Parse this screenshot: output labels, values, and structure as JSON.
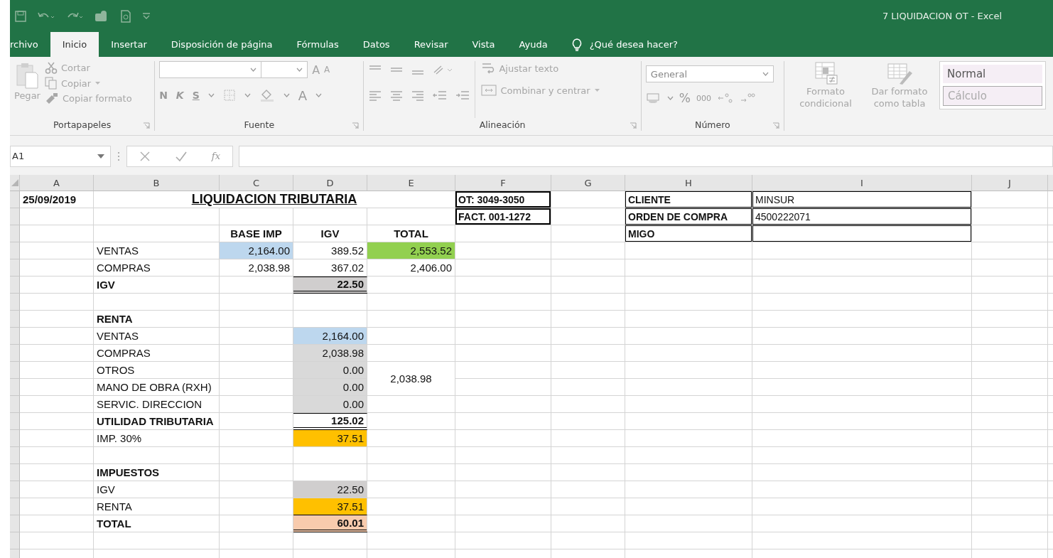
{
  "window": {
    "title": "7 LIQUIDACION OT  -  Excel"
  },
  "tabs": [
    {
      "label": "rchivo",
      "selected": false
    },
    {
      "label": "Inicio",
      "selected": true
    },
    {
      "label": "Insertar",
      "selected": false
    },
    {
      "label": "Disposición de página",
      "selected": false
    },
    {
      "label": "Fórmulas",
      "selected": false
    },
    {
      "label": "Datos",
      "selected": false
    },
    {
      "label": "Revisar",
      "selected": false
    },
    {
      "label": "Vista",
      "selected": false
    },
    {
      "label": "Ayuda",
      "selected": false
    }
  ],
  "tell_me": "¿Qué desea hacer?",
  "clipboard": {
    "label": "Portapapeles",
    "paste": "Pegar",
    "cut": "Cortar",
    "copy": "Copiar",
    "format_painter": "Copiar formato"
  },
  "font": {
    "label": "Fuente",
    "grow": "A",
    "shrink": "A",
    "bold": "N",
    "italic": "K",
    "underline": "S",
    "font_color": "A"
  },
  "alignment": {
    "label": "Alineación",
    "wrap": "Ajustar texto",
    "merge": "Combinar y centrar"
  },
  "number": {
    "label": "Número",
    "format": "General",
    "percent": "%",
    "thousands": "000"
  },
  "styles": {
    "conditional": "Formato condicional",
    "as_table": "Dar formato como tabla",
    "cell_styles": [
      "Normal",
      "Cálculo"
    ]
  },
  "formula_bar": {
    "name_box": "A1",
    "function_label": "fx"
  },
  "sheet": {
    "columns": [
      {
        "label": "A"
      },
      {
        "label": "B"
      },
      {
        "label": "C"
      },
      {
        "label": "D"
      },
      {
        "label": "E"
      },
      {
        "label": "F"
      },
      {
        "label": "G"
      },
      {
        "label": "H"
      },
      {
        "label": "I"
      },
      {
        "label": "J"
      }
    ],
    "rows": [
      {
        "cells": [
          {
            "kind": "text",
            "bold": true,
            "text": "25/09/2019"
          },
          {
            "kind": "title",
            "merged_across": true,
            "text": "LIQUIDACION TRIBUTARIA"
          },
          "",
          "",
          "",
          {
            "kind": "text",
            "bold": true,
            "thick_box": true,
            "text": "OT: 3049-3050"
          },
          "",
          {
            "kind": "text",
            "bold": true,
            "boxed": true,
            "text": "CLIENTE"
          },
          {
            "kind": "text",
            "bold": false,
            "boxed": true,
            "text": "MINSUR"
          }
        ]
      },
      {
        "cells": [
          "",
          "",
          "",
          "",
          "",
          {
            "kind": "text",
            "bold": true,
            "thick_box": true,
            "text": "FACT. 001-1272"
          },
          "",
          {
            "kind": "text",
            "bold": true,
            "boxed": true,
            "text": "ORDEN DE COMPRA"
          },
          {
            "kind": "text",
            "bold": false,
            "boxed": true,
            "text": "4500222071"
          }
        ]
      },
      {
        "cells": [
          "",
          "",
          {
            "kind": "heading",
            "text": "BASE IMP"
          },
          {
            "kind": "heading",
            "text": "IGV"
          },
          {
            "kind": "heading",
            "text": "TOTAL"
          },
          "",
          "",
          {
            "kind": "text",
            "bold": true,
            "boxed": true,
            "text": "MIGO"
          },
          {
            "kind": "text",
            "boxed": true
          }
        ]
      },
      {
        "cells": [
          "",
          {
            "kind": "text",
            "bold": false,
            "text": "VENTAS"
          },
          {
            "kind": "number",
            "bold": false,
            "color": "#bdd7ee",
            "text": "2,164.00"
          },
          {
            "kind": "number",
            "bold": false,
            "text": "389.52"
          },
          {
            "kind": "number",
            "bold": false,
            "color": "#92d050",
            "text": "2,553.52"
          }
        ]
      },
      {
        "cells": [
          "",
          {
            "kind": "text",
            "bold": false,
            "text": "COMPRAS"
          },
          {
            "kind": "number",
            "bold": false,
            "text": "2,038.98"
          },
          {
            "kind": "number",
            "bold": false,
            "text": "367.02"
          },
          {
            "kind": "number",
            "bold": false,
            "text": "2,406.00"
          }
        ]
      },
      {
        "cells": [
          "",
          {
            "kind": "text",
            "bold": true,
            "text": "IGV"
          },
          "",
          {
            "kind": "number",
            "bold": true,
            "color": "#d0cece",
            "top_rule": true,
            "double_underline": true,
            "text": "22.50"
          }
        ]
      },
      {
        "cells": []
      },
      {
        "cells": [
          "",
          {
            "kind": "text",
            "bold": true,
            "text": "RENTA"
          }
        ]
      },
      {
        "cells": [
          "",
          {
            "kind": "text",
            "bold": false,
            "text": "VENTAS"
          },
          "",
          {
            "kind": "number",
            "bold": false,
            "color": "#bdd7ee",
            "text": "2,164.00"
          }
        ]
      },
      {
        "cells": [
          "",
          {
            "kind": "text",
            "bold": false,
            "text": "COMPRAS"
          },
          "",
          {
            "kind": "number",
            "bold": false,
            "color": "#d9d9d9",
            "text": "2,038.98"
          }
        ]
      },
      {
        "cells": [
          "",
          {
            "kind": "text",
            "bold": false,
            "text": "OTROS"
          },
          "",
          {
            "kind": "number",
            "bold": false,
            "color": "#d9d9d9",
            "text": "0.00"
          },
          {
            "kind": "centered",
            "merged_down": true,
            "text": "2,038.98"
          }
        ]
      },
      {
        "cells": [
          "",
          {
            "kind": "text",
            "bold": false,
            "text": "MANO DE OBRA (RXH)"
          },
          "",
          {
            "kind": "number",
            "bold": false,
            "color": "#d9d9d9",
            "text": "0.00"
          }
        ]
      },
      {
        "cells": [
          "",
          {
            "kind": "text",
            "bold": false,
            "text": "SERVIC. DIRECCION"
          },
          "",
          {
            "kind": "number",
            "bold": false,
            "color": "#d9d9d9",
            "text": "0.00"
          }
        ]
      },
      {
        "cells": [
          "",
          {
            "kind": "text",
            "bold": true,
            "text": "UTILIDAD TRIBUTARIA"
          },
          "",
          {
            "kind": "number",
            "bold": true,
            "top_rule": true,
            "double_underline": true,
            "text": "125.02"
          }
        ]
      },
      {
        "cells": [
          "",
          {
            "kind": "text",
            "bold": false,
            "text": "IMP. 30%"
          },
          "",
          {
            "kind": "number",
            "bold": false,
            "color": "#ffc000",
            "text": "37.51"
          }
        ]
      },
      {
        "cells": []
      },
      {
        "cells": [
          "",
          {
            "kind": "text",
            "bold": true,
            "text": "IMPUESTOS"
          }
        ]
      },
      {
        "cells": [
          "",
          {
            "kind": "text",
            "bold": false,
            "text": "IGV"
          },
          "",
          {
            "kind": "number",
            "bold": false,
            "color": "#d0cece",
            "text": "22.50"
          }
        ]
      },
      {
        "cells": [
          "",
          {
            "kind": "text",
            "bold": false,
            "text": "RENTA"
          },
          "",
          {
            "kind": "number",
            "bold": false,
            "color": "#ffc000",
            "bottom_rule": true,
            "text": "37.51"
          }
        ]
      },
      {
        "cells": [
          "",
          {
            "kind": "text",
            "bold": true,
            "text": "TOTAL"
          },
          "",
          {
            "kind": "number",
            "bold": true,
            "color": "#f8cbad",
            "double_underline": true,
            "text": "60.01"
          }
        ]
      },
      {
        "cells": []
      },
      {
        "cells": []
      }
    ]
  }
}
